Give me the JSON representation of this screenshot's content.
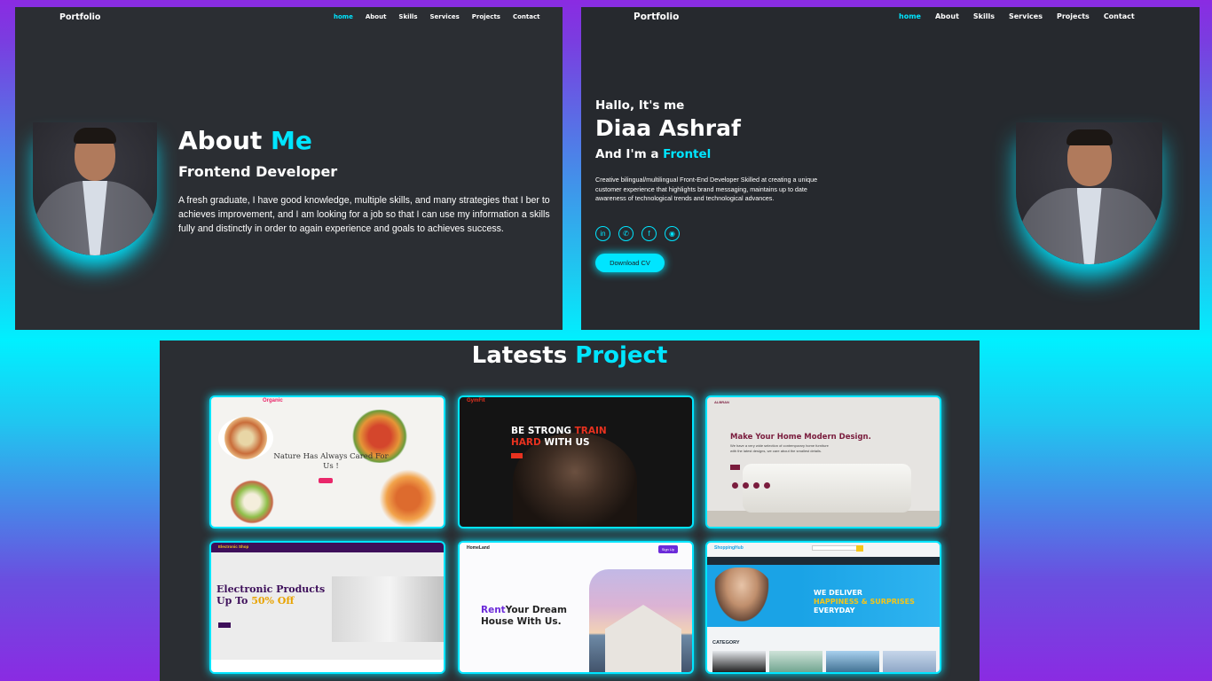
{
  "nav": {
    "logo": "Portfolio",
    "links": [
      "home",
      "About",
      "Skills",
      "Services",
      "Projects",
      "Contact"
    ]
  },
  "about": {
    "title_prefix": "About ",
    "title_accent": "Me",
    "subtitle": "Frontend Developer",
    "text": "A fresh graduate, I have good knowledge, multiple skills, and many strategies that I ber to achieves improvement, and I am looking for a job so that I can use my information a skills fully and distinctly in order to again experience and goals to achieves success."
  },
  "hero": {
    "greeting": "Hallo, It's me",
    "name": "Diaa Ashraf",
    "role_prefix": "And I'm a ",
    "role_typed": "Frontel",
    "description": "Creative bilingual/multilingual Front-End Developer Skilled at creating a unique customer experience that highlights brand messaging, maintains up to date awareness of technological trends and technological advances.",
    "socials": [
      "linkedin-icon",
      "whatsapp-icon",
      "facebook-icon",
      "github-icon"
    ],
    "cv_button": "Download CV"
  },
  "projects": {
    "title_prefix": "Latests ",
    "title_accent": "Project",
    "cards": [
      {
        "logo": "Organic",
        "headline": "Nature Has Always Cared For Us !"
      },
      {
        "logo": "GymFit",
        "headline_line1_a": "BE STRONG ",
        "headline_line1_b": "TRAIN",
        "headline_line2_a": "HARD ",
        "headline_line2_b": "WITH US"
      },
      {
        "logo": "ALBRAN",
        "headline": "Make Your Home Modern Design.",
        "desc": "We have a very wide selection of contemporary home furniture with the latest designs, we care about the smallest details."
      },
      {
        "logo": "Electronic Shop",
        "headline_line1": "Electronic Products",
        "headline_line2_a": "Up To ",
        "headline_line2_b": "50% Off"
      },
      {
        "logo": "HomeLand",
        "headline_accent": "Rent",
        "headline_rest": "Your Dream",
        "headline_line2": "House With Us.",
        "signup": "Sign Up"
      },
      {
        "logo": "ShoppingHub",
        "deliver_line1": "WE DELIVER",
        "deliver_yellow": "HAPPINESS & SURPRISES",
        "deliver_rest": " EVERYDAY",
        "category": "CATEGORY"
      }
    ]
  },
  "colors": {
    "accent": "#00e5ff",
    "panel": "#2b2e33"
  }
}
